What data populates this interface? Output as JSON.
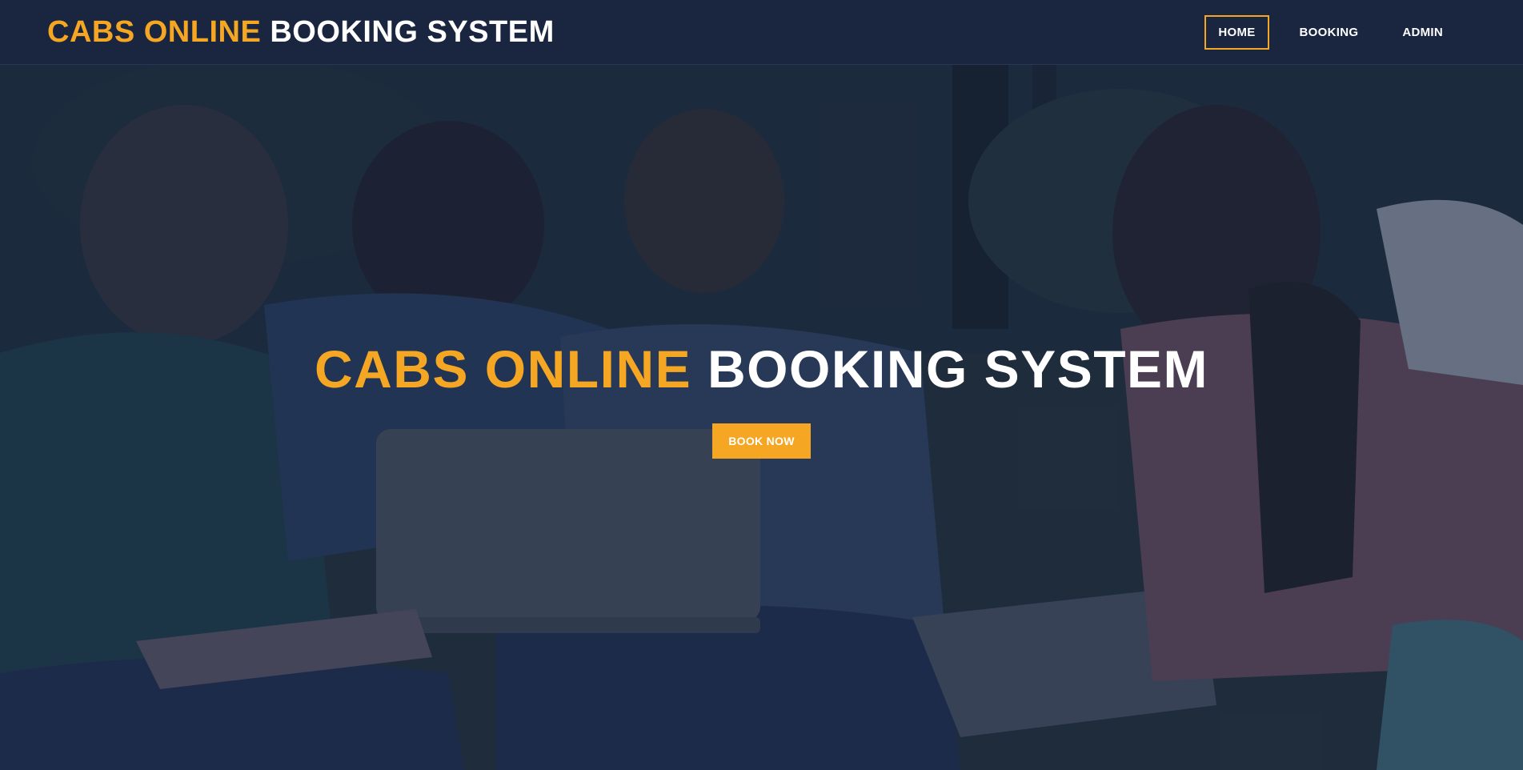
{
  "header": {
    "brand_accent": "CABS ONLINE",
    "brand_rest": "BOOKING SYSTEM"
  },
  "nav": {
    "items": [
      {
        "label": "HOME",
        "active": true
      },
      {
        "label": "BOOKING",
        "active": false
      },
      {
        "label": "ADMIN",
        "active": false
      }
    ]
  },
  "hero": {
    "title_accent": "CABS ONLINE",
    "title_rest": "BOOKING SYSTEM",
    "cta_label": "BOOK NOW",
    "background_image": "students-sitting-on-grass-with-laptop"
  },
  "colors": {
    "navbar_bg": "#1a2540",
    "accent": "#f5a623",
    "text": "#ffffff"
  }
}
